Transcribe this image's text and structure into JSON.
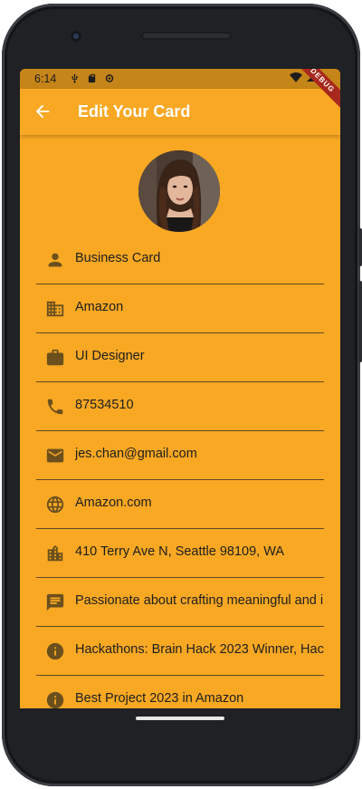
{
  "status_bar": {
    "time": "6:14"
  },
  "debug_banner": "DEBUG",
  "app_bar": {
    "title": "Edit Your Card"
  },
  "fields": [
    {
      "icon": "person-icon",
      "value": "Business Card"
    },
    {
      "icon": "business-icon",
      "value": "Amazon"
    },
    {
      "icon": "briefcase-icon",
      "value": "UI Designer"
    },
    {
      "icon": "phone-icon",
      "value": "87534510"
    },
    {
      "icon": "email-icon",
      "value": "jes.chan@gmail.com"
    },
    {
      "icon": "globe-icon",
      "value": "Amazon.com"
    },
    {
      "icon": "location-city-icon",
      "value": "410 Terry Ave N, Seattle 98109, WA"
    },
    {
      "icon": "chat-icon",
      "value": "Passionate about crafting meaningful and i"
    },
    {
      "icon": "info-icon",
      "value": "Hackathons: Brain Hack 2023 Winner, Hack"
    },
    {
      "icon": "info-icon",
      "value": "Best Project 2023 in Amazon"
    }
  ],
  "colors": {
    "primary": "#f8a823",
    "status_bar": "#c68518",
    "icon": "#6b4f1d",
    "divider": "#5f4a24"
  }
}
